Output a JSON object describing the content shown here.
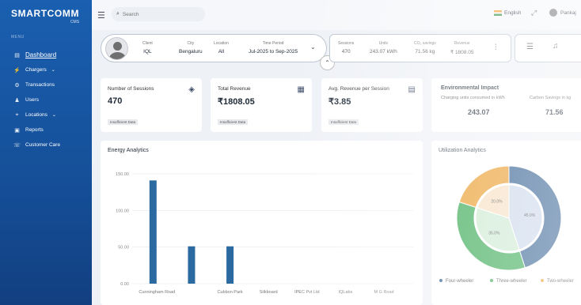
{
  "brand": {
    "name": "SMARTCOMM",
    "sub": "CMS"
  },
  "sidebar": {
    "header": "MENU",
    "items": [
      {
        "label": "Dashboard",
        "icon": "dashboard-icon",
        "glyph": "▤"
      },
      {
        "label": "Chargers",
        "icon": "charger-icon",
        "glyph": "⚡"
      },
      {
        "label": "Transactions",
        "icon": "transactions-icon",
        "glyph": "⚙"
      },
      {
        "label": "Users",
        "icon": "users-icon",
        "glyph": "♟"
      },
      {
        "label": "Locations",
        "icon": "location-icon",
        "glyph": "⌖"
      },
      {
        "label": "Reports",
        "icon": "reports-icon",
        "glyph": "▣"
      },
      {
        "label": "Customer Care",
        "icon": "customer-care-icon",
        "glyph": "☏"
      }
    ]
  },
  "topbar": {
    "search_placeholder": "Search",
    "language": "English",
    "user": "Pankaj"
  },
  "filter": {
    "client_label": "Client",
    "client": "IQL",
    "city_label": "City",
    "city": "Bengaluru",
    "location_label": "Location",
    "location": "All",
    "period_label": "Time Period",
    "period": "Jul-2025 to Sep-2025"
  },
  "summary": {
    "sessions_label": "Sessions",
    "sessions": "470",
    "units_label": "Units",
    "units": "243.07 kWh",
    "co2_label": "CO₂ savings",
    "co2": "71.56 kg",
    "revenue_label": "Revenue",
    "revenue": "₹ 1808.05"
  },
  "kpis": [
    {
      "title": "Number of Sessions",
      "value": "470",
      "badge": "Insufficient Data"
    },
    {
      "title": "Total Revenue",
      "value": "₹1808.05",
      "badge": "Insufficient Data"
    },
    {
      "title": "Avg. Revenue per Session",
      "value": "₹3.85",
      "badge": "Insufficient Data"
    }
  ],
  "environmental": {
    "title": "Environmental Impact",
    "units_label": "Charging units consumed in kWh",
    "units": "243.07",
    "carbon_label": "Carbon Savings in kg",
    "carbon": "71.56"
  },
  "energy": {
    "title": "Energy Analytics",
    "chart_data": {
      "type": "bar",
      "categories": [
        "Cunningham Road",
        "",
        "Cubbon Park",
        "Silkboard",
        "IPEC Pvt Ltd",
        "IQLabs",
        "M G Road"
      ],
      "x_tick_labels": [
        "Cunningham Road",
        "Cubbon Park",
        "Silkboard",
        "IPEC Pvt Ltd",
        "IQLabs",
        "M G Road"
      ],
      "values": [
        141,
        51,
        51,
        0,
        0,
        0,
        0
      ],
      "ylim": [
        0,
        150
      ],
      "y_ticks": [
        "0.00",
        "50.00",
        "100.00",
        "150.00"
      ],
      "color": "#2a6aa0"
    }
  },
  "utilization": {
    "title": "Utilization Analytics",
    "chart_data": {
      "type": "pie",
      "labels": [
        "Four-wheeler",
        "Three-wheeler",
        "Two-wheeler"
      ],
      "values": [
        45.0,
        35.0,
        20.0
      ],
      "value_labels": [
        "45.0%",
        "35.0%",
        "20.0%"
      ],
      "colors": [
        "#1e4f86",
        "#27a145",
        "#e8941a"
      ],
      "legend": "bottom"
    }
  }
}
